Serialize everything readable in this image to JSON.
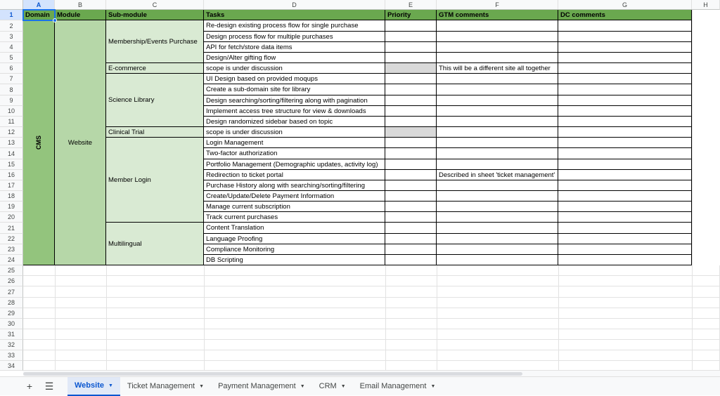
{
  "columns": [
    "A",
    "B",
    "C",
    "D",
    "E",
    "F",
    "G",
    "H"
  ],
  "rows": [
    "1",
    "2",
    "3",
    "4",
    "5",
    "6",
    "7",
    "8",
    "9",
    "10",
    "11",
    "12",
    "13",
    "14",
    "15",
    "16",
    "17",
    "18",
    "19",
    "20",
    "21",
    "22",
    "23",
    "24",
    "25",
    "26",
    "27",
    "28",
    "29",
    "30",
    "31",
    "32",
    "33",
    "34"
  ],
  "header": {
    "domain": "Domain",
    "module": "Module",
    "submodule": "Sub-module",
    "tasks": "Tasks",
    "priority": "Priority",
    "gtm": "GTM comments",
    "dc": "DC comments"
  },
  "domain_value": "CMS",
  "module_value": "Website",
  "submodules": [
    "Membership/Events Purchase",
    "E-commerce",
    "Science Library",
    "Clinical Trial",
    "Member Login",
    "Multilingual"
  ],
  "tasks": [
    "Re-design existing process flow for single purchase",
    "Design process flow for multiple purchases",
    "API for fetch/store data items",
    "Design/Alter gifting flow",
    "scope is under discussion",
    "UI Design based on provided moqups",
    "Create a sub-domain site for library",
    "Design searching/sorting/filtering along with pagination",
    "Implement access tree structure for view & downloads",
    "Design randomized sidebar based on topic",
    "scope is under discussion",
    "Login Management",
    "Two-factor authorization",
    "Portfolio Management (Demographic updates, activity log)",
    "Redirection to ticket portal",
    "Purchase History along with searching/sorting/filtering",
    "Create/Update/Delete Payment Information",
    "Manage current subscription",
    "Track current purchases",
    "Content Translation",
    "Language Proofing",
    "Compliance Monitoring",
    "DB Scripting"
  ],
  "gtm_comments": {
    "row6": "This will be a different site all together",
    "row16": "Described in sheet 'ticket management'"
  },
  "tabs": {
    "add_icon": "+",
    "menu_icon": "☰",
    "items": [
      "Website",
      "Ticket Management",
      "Payment Management",
      "CRM",
      "Email Management"
    ]
  },
  "colors": {
    "header": "#6aa84f",
    "domain": "#93c47d",
    "module": "#b6d7a8",
    "submodule": "#d9ead3",
    "priority_grey": "#d9d9d9",
    "active_tab": "#0b57d0"
  }
}
